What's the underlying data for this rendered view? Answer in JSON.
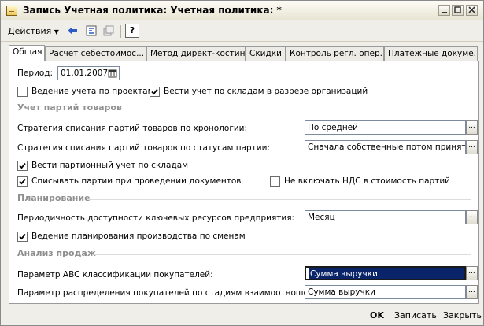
{
  "window": {
    "title": "Запись Учетная политика: Учетная политика: *"
  },
  "toolbar": {
    "actions_label": "Действия",
    "help_label": "?"
  },
  "tabs": [
    {
      "label": "Общая"
    },
    {
      "label": "Расчет себестоимос..."
    },
    {
      "label": "Метод директ-костинг"
    },
    {
      "label": "Скидки"
    },
    {
      "label": "Контроль регл. опер..."
    },
    {
      "label": "Платежные докуме..."
    }
  ],
  "general": {
    "period_label": "Период:",
    "period_value": "01.01.2007",
    "projects_label": "Ведение учета по проектам",
    "projects_checked": false,
    "warehouses_org_label": "Вести учет по складам в разрезе организаций",
    "warehouses_org_checked": true
  },
  "batches": {
    "section_title": "Учет партий товаров",
    "chrono_label": "Стратегия списания партий товаров по хронологии:",
    "chrono_value": "По средней",
    "status_label": "Стратегия списания партий товаров по статусам партии:",
    "status_value": "Сначала собственные потом принятые",
    "by_warehouse_label": "Вести партионный учет по складам",
    "by_warehouse_checked": true,
    "write_off_label": "Списывать партии при проведении документов",
    "write_off_checked": true,
    "no_vat_label": "Не включать НДС в стоимость партий",
    "no_vat_checked": false
  },
  "planning": {
    "section_title": "Планирование",
    "periodicity_label": "Периодичность доступности ключевых ресурсов предприятия:",
    "periodicity_value": "Месяц",
    "shifts_label": "Ведение планирования производства по сменам",
    "shifts_checked": true
  },
  "sales": {
    "section_title": "Анализ продаж",
    "abc_label": "Параметр ABC классификации покупателей:",
    "abc_value": "Сумма выручки",
    "stages_label": "Параметр распределения покупателей по стадиям взаимоотношений:",
    "stages_value": "Сумма выручки"
  },
  "buttons": {
    "ok": "OK",
    "save": "Записать",
    "close": "Закрыть"
  }
}
